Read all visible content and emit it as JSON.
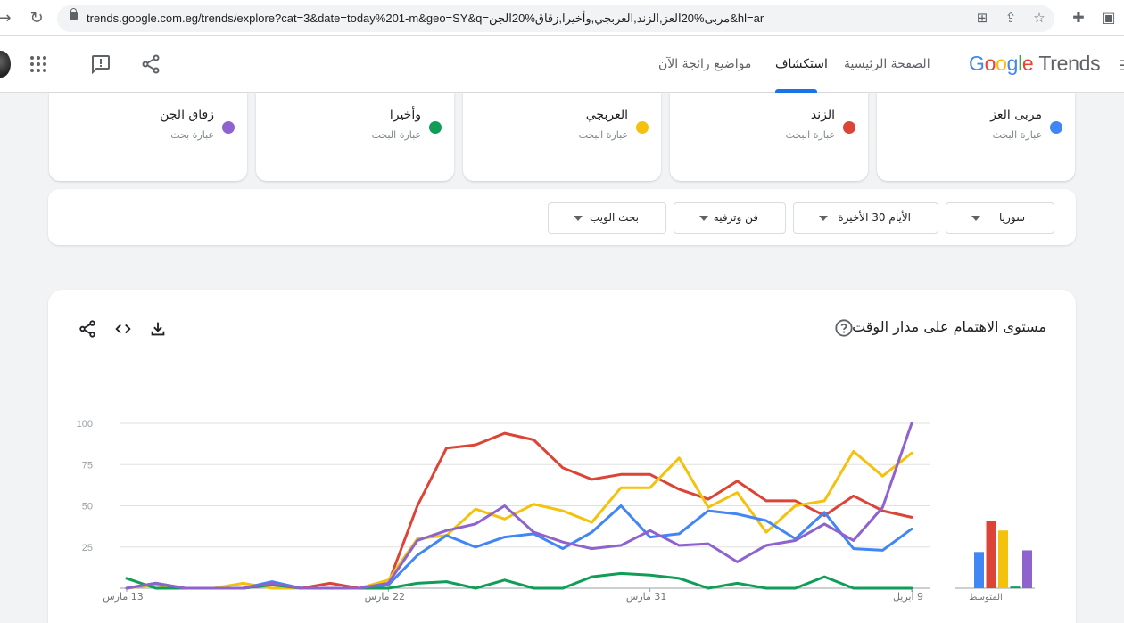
{
  "browser": {
    "url": "trends.google.com.eg/trends/explore?cat=3&date=today%201-m&geo=SY&q=مربى%20العز,الزند,العربجي,وأخيرا,زقاق%20الجن&hl=ar"
  },
  "header": {
    "logo_google": [
      "G",
      "o",
      "o",
      "g",
      "l",
      "e"
    ],
    "logo_trends": "Trends",
    "tabs": [
      "الصفحة الرئيسية",
      "استكشاف",
      "مواضيع رائجة الآن"
    ],
    "active_tab": "استكشاف"
  },
  "terms": [
    {
      "name": "مربى العز",
      "type": "عبارة البحث",
      "color": "#4285f4"
    },
    {
      "name": "الزند",
      "type": "عبارة البحث",
      "color": "#db4437"
    },
    {
      "name": "العربجي",
      "type": "عبارة البحث",
      "color": "#f4c20d"
    },
    {
      "name": "وأخيرا",
      "type": "عبارة البحث",
      "color": "#0f9d58"
    },
    {
      "name": "زقاق الجن",
      "type": "عبارة بحث",
      "color": "#8e63ce"
    }
  ],
  "filters": {
    "region": "سوريا",
    "period": "الأيام 30 الأخيرة",
    "category": "فن وترفيه",
    "search_type": "بحث الويب"
  },
  "chart": {
    "title": "مستوى الاهتمام على مدار الوقت"
  },
  "chart_data": {
    "type": "line",
    "y_ticks": [
      25,
      50,
      75,
      100
    ],
    "ylim": [
      0,
      100
    ],
    "x_labels": [
      {
        "label": "13 مارس",
        "index": 0
      },
      {
        "label": "22 مارس",
        "index": 9
      },
      {
        "label": "31 مارس",
        "index": 18
      },
      {
        "label": "9 أبريل",
        "index": 27
      }
    ],
    "series": [
      {
        "name": "مربى العز",
        "color": "#4285f4",
        "average": 22,
        "values": [
          0,
          3,
          0,
          0,
          0,
          4,
          0,
          0,
          0,
          2,
          20,
          32,
          25,
          31,
          33,
          24,
          34,
          50,
          31,
          33,
          47,
          45,
          41,
          30,
          46,
          24,
          23,
          36
        ]
      },
      {
        "name": "الزند",
        "color": "#db4437",
        "average": 41,
        "values": [
          0,
          3,
          0,
          0,
          0,
          2,
          0,
          3,
          0,
          3,
          50,
          85,
          87,
          94,
          90,
          73,
          66,
          69,
          69,
          60,
          54,
          65,
          53,
          53,
          44,
          56,
          47,
          43
        ]
      },
      {
        "name": "العربجي",
        "color": "#f4c20d",
        "average": 35,
        "values": [
          0,
          2,
          0,
          0,
          3,
          0,
          0,
          0,
          0,
          5,
          30,
          32,
          48,
          42,
          51,
          47,
          40,
          61,
          61,
          79,
          49,
          58,
          34,
          50,
          53,
          83,
          68,
          82
        ]
      },
      {
        "name": "وأخيرا",
        "color": "#0f9d58",
        "average": 1,
        "values": [
          6,
          0,
          0,
          0,
          0,
          2,
          0,
          0,
          0,
          0,
          3,
          4,
          0,
          5,
          0,
          0,
          7,
          9,
          8,
          6,
          0,
          3,
          0,
          0,
          7,
          0,
          0,
          0
        ]
      },
      {
        "name": "زقاق الجن",
        "color": "#8e63ce",
        "average": 23,
        "values": [
          0,
          3,
          0,
          0,
          0,
          3,
          0,
          0,
          0,
          3,
          29,
          35,
          39,
          50,
          34,
          28,
          24,
          26,
          35,
          26,
          27,
          16,
          26,
          29,
          39,
          29,
          49,
          100
        ]
      }
    ],
    "average_label": "المتوسط"
  }
}
